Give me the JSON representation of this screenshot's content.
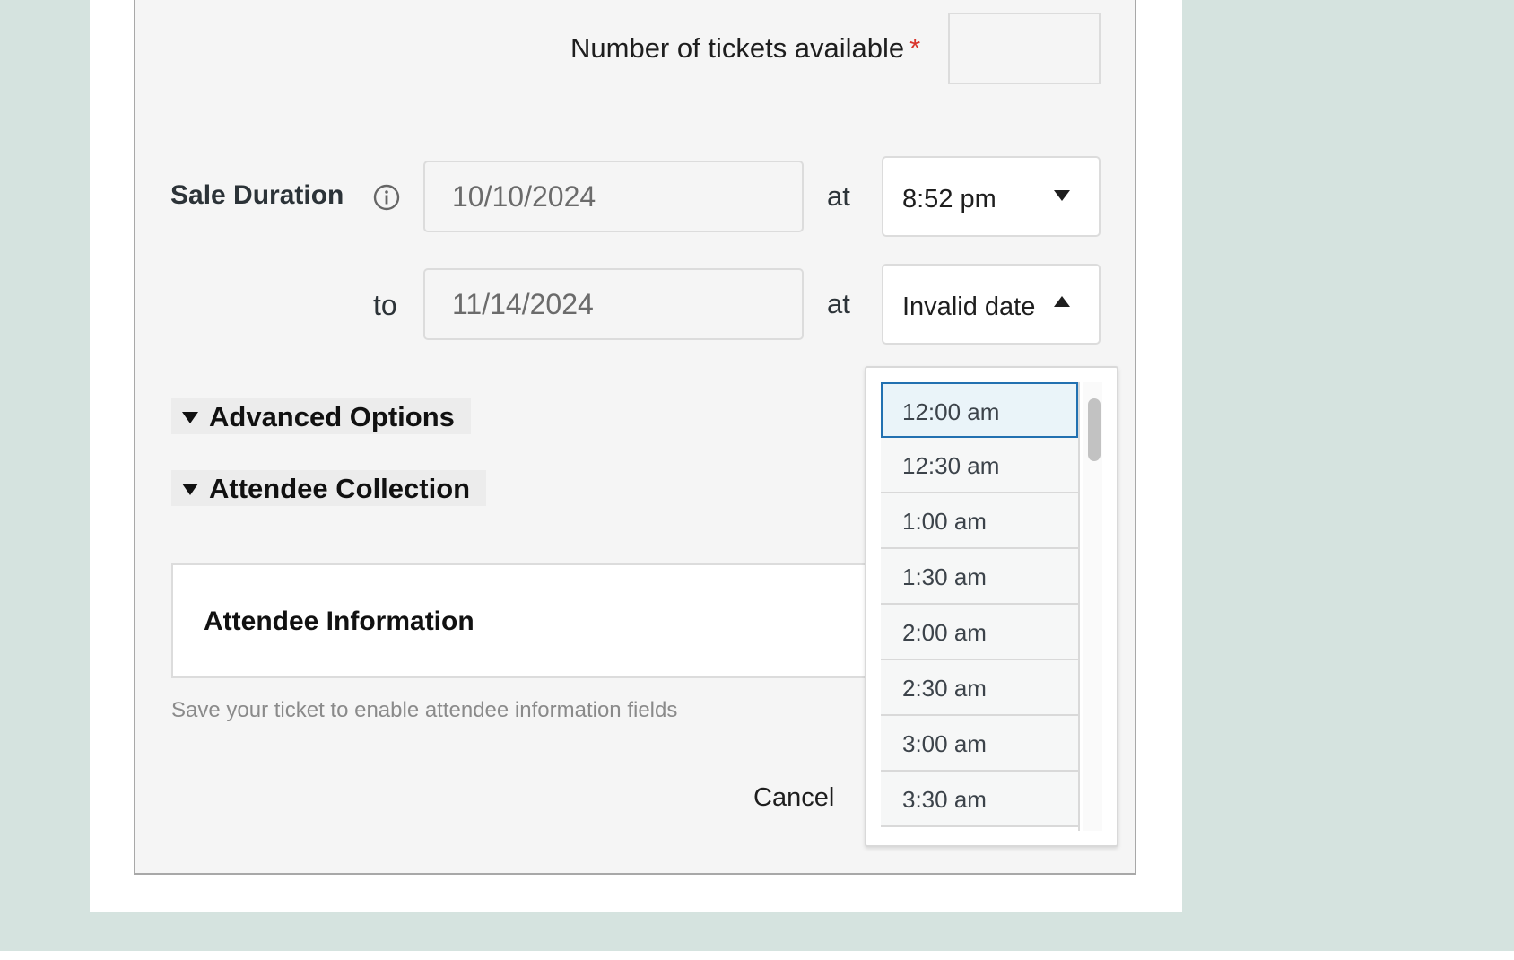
{
  "form": {
    "tickets_label": "Number of tickets available",
    "required_mark": "*",
    "tickets_value": "",
    "sale_duration_label": "Sale Duration",
    "start_date": "10/10/2024",
    "at_label": "at",
    "start_time": "8:52 pm",
    "to_label": "to",
    "end_date": "11/14/2024",
    "end_time": "Invalid date",
    "advanced_options_label": "Advanced Options",
    "attendee_collection_label": "Attendee Collection",
    "attendee_information_title": "Attendee Information",
    "help_text": "Save your ticket to enable attendee information fields",
    "cancel_label": "Cancel"
  },
  "time_dropdown": {
    "options": [
      "12:00 am",
      "12:30 am",
      "1:00 am",
      "1:30 am",
      "2:00 am",
      "2:30 am",
      "3:00 am",
      "3:30 am"
    ],
    "highlighted": "12:00 am"
  },
  "colors": {
    "background": "#d5e3df",
    "panel": "#f5f5f5",
    "required": "#d9342b",
    "focus_border": "#2271b1"
  }
}
